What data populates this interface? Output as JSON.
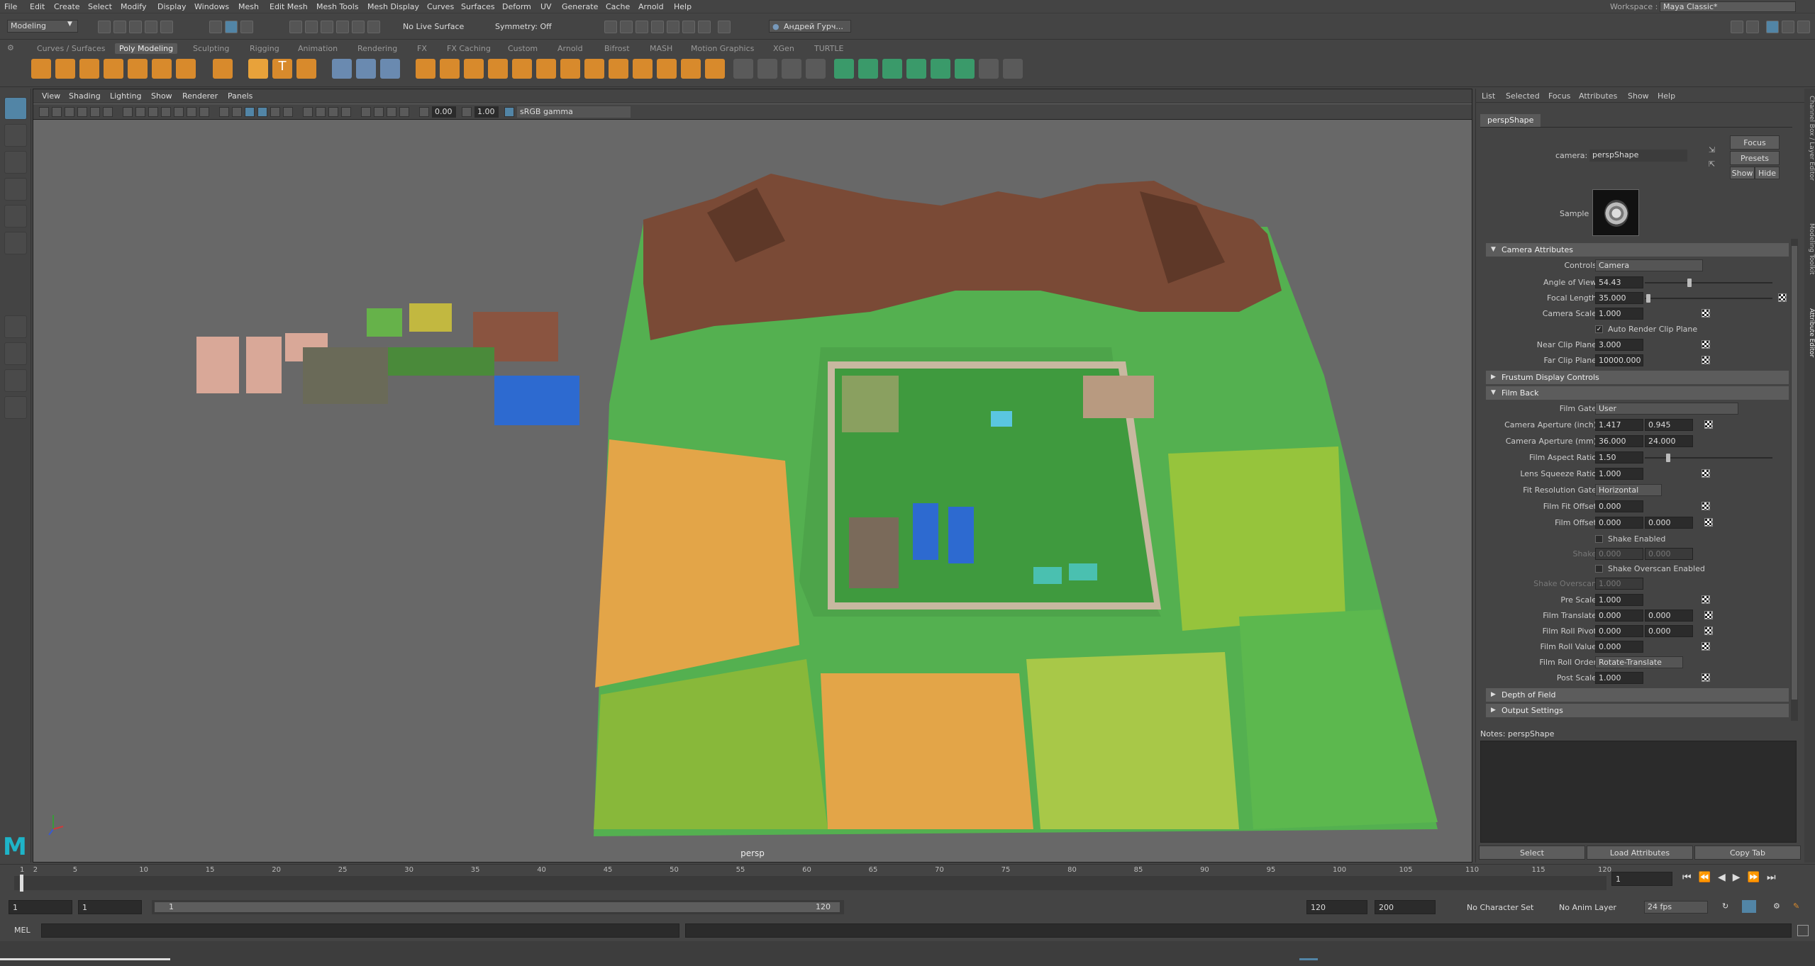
{
  "menu": [
    "File",
    "Edit",
    "Create",
    "Select",
    "Modify",
    "Display",
    "Windows",
    "Mesh",
    "Edit Mesh",
    "Mesh Tools",
    "Mesh Display",
    "Curves",
    "Surfaces",
    "Deform",
    "UV",
    "Generate",
    "Cache",
    "Arnold",
    "Help"
  ],
  "workspace": {
    "label": "Workspace :",
    "value": "Maya Classic*"
  },
  "status": {
    "mode": "Modeling",
    "live_surface": "No Live Surface",
    "symmetry": "Symmetry: Off",
    "user": "Андрей Гурч..."
  },
  "shelf_tabs": [
    "Curves / Surfaces",
    "Poly Modeling",
    "Sculpting",
    "Rigging",
    "Animation",
    "Rendering",
    "FX",
    "FX Caching",
    "Custom",
    "Arnold",
    "Bifrost",
    "MASH",
    "Motion Graphics",
    "XGen",
    "TURTLE"
  ],
  "shelf_active": "Poly Modeling",
  "viewport": {
    "menu": [
      "View",
      "Shading",
      "Lighting",
      "Show",
      "Renderer",
      "Panels"
    ],
    "exposure": "0.00",
    "gamma": "1.00",
    "color_space": "sRGB gamma",
    "camera_label": "persp"
  },
  "attr_editor": {
    "menu": [
      "List",
      "Selected",
      "Focus",
      "Attributes",
      "Show",
      "Help"
    ],
    "node_tab": "perspShape",
    "camera_label": "camera:",
    "camera_value": "perspShape",
    "focus_btn": "Focus",
    "presets_btn": "Presets",
    "show_btn": "Show",
    "hide_btn": "Hide",
    "sample_label": "Sample",
    "sections": {
      "camera_attributes": "Camera Attributes",
      "frustum": "Frustum Display Controls",
      "film_back": "Film Back",
      "dof": "Depth of Field",
      "output": "Output Settings"
    },
    "controls": {
      "label": "Controls",
      "value": "Camera"
    },
    "angle_of_view": {
      "label": "Angle of View",
      "value": "54.43"
    },
    "focal_length": {
      "label": "Focal Length",
      "value": "35.000"
    },
    "camera_scale": {
      "label": "Camera Scale",
      "value": "1.000"
    },
    "auto_render_clip": {
      "label": "Auto Render Clip Plane"
    },
    "near_clip": {
      "label": "Near Clip Plane",
      "value": "3.000"
    },
    "far_clip": {
      "label": "Far Clip Plane",
      "value": "10000.000"
    },
    "film_gate": {
      "label": "Film Gate",
      "value": "User"
    },
    "aperture_inch": {
      "label": "Camera Aperture (inch)",
      "v1": "1.417",
      "v2": "0.945"
    },
    "aperture_mm": {
      "label": "Camera Aperture (mm)",
      "v1": "36.000",
      "v2": "24.000"
    },
    "film_aspect": {
      "label": "Film Aspect Ratio",
      "value": "1.50"
    },
    "lens_squeeze": {
      "label": "Lens Squeeze Ratio",
      "value": "1.000"
    },
    "fit_resolution": {
      "label": "Fit Resolution Gate",
      "value": "Horizontal"
    },
    "film_fit_offset": {
      "label": "Film Fit Offset",
      "value": "0.000"
    },
    "film_offset": {
      "label": "Film Offset",
      "v1": "0.000",
      "v2": "0.000"
    },
    "shake_enabled": {
      "label": "Shake Enabled"
    },
    "shake": {
      "label": "Shake",
      "v1": "0.000",
      "v2": "0.000"
    },
    "shake_overscan_enabled": {
      "label": "Shake Overscan Enabled"
    },
    "shake_overscan": {
      "label": "Shake Overscan",
      "value": "1.000"
    },
    "pre_scale": {
      "label": "Pre Scale",
      "value": "1.000"
    },
    "film_translate": {
      "label": "Film Translate",
      "v1": "0.000",
      "v2": "0.000"
    },
    "film_roll_pivot": {
      "label": "Film Roll Pivot",
      "v1": "0.000",
      "v2": "0.000"
    },
    "film_roll_value": {
      "label": "Film Roll Value",
      "value": "0.000"
    },
    "film_roll_order": {
      "label": "Film Roll Order",
      "value": "Rotate-Translate"
    },
    "post_scale": {
      "label": "Post Scale",
      "value": "1.000"
    },
    "notes": "Notes:  perspShape",
    "bottom_buttons": [
      "Select",
      "Load Attributes",
      "Copy Tab"
    ]
  },
  "side_tabs": [
    "Channel Box / Layer Editor",
    "Modeling Toolkit",
    "Attribute Editor"
  ],
  "timeline": {
    "ticks": [
      "1",
      "2",
      "5",
      "10",
      "15",
      "20",
      "25",
      "30",
      "35",
      "40",
      "45",
      "50",
      "55",
      "60",
      "65",
      "70",
      "75",
      "80",
      "85",
      "90",
      "95",
      "100",
      "105",
      "110",
      "115",
      "120"
    ],
    "current_frame": "1"
  },
  "range": {
    "start": "1",
    "playback_start": "1",
    "slider_start": "1",
    "slider_end": "120",
    "playback_end": "120",
    "end": "200",
    "character_set": "No Character Set",
    "anim_layer": "No Anim Layer",
    "fps": "24 fps"
  },
  "cmd": {
    "label": "MEL"
  },
  "colors": {
    "accent": "#5285a6",
    "viewport_bg": "#686868",
    "panel_bg": "#444444"
  }
}
